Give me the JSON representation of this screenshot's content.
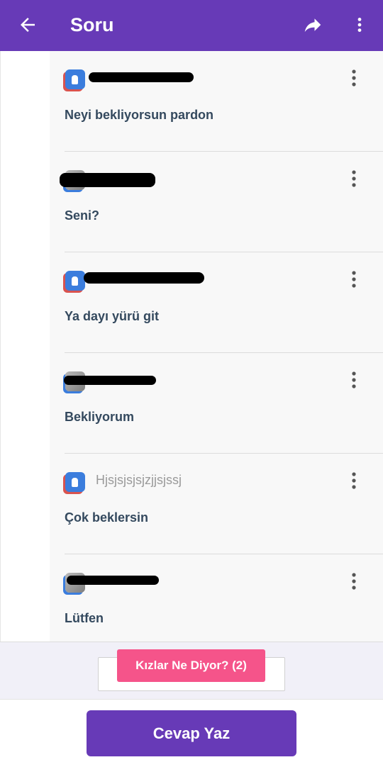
{
  "header": {
    "title": "Soru",
    "back_icon": "arrow-left-icon",
    "share_icon": "share-icon",
    "more_icon": "more-vert-icon",
    "background": "#673ab7"
  },
  "replies": [
    {
      "username": "",
      "avatar": "app-avatar",
      "text": "Neyi bekliyorsun pardon"
    },
    {
      "username": "",
      "avatar": "photo-avatar",
      "text": "Seni?"
    },
    {
      "username": "",
      "avatar": "app-avatar",
      "text": "Ya dayı yürü git"
    },
    {
      "username": "",
      "avatar": "photo-avatar",
      "text": "Bekliyorum"
    },
    {
      "username": "Hjsjsjsjsjzjjsjssj",
      "avatar": "app-avatar",
      "text": "Çok beklersin"
    },
    {
      "username": "",
      "avatar": "photo-avatar",
      "text": "Lütfen"
    }
  ],
  "girls_button": {
    "label": "Kızlar Ne Diyor? (2)",
    "color": "#f5548a"
  },
  "answer_button": {
    "label": "Cevap Yaz"
  }
}
